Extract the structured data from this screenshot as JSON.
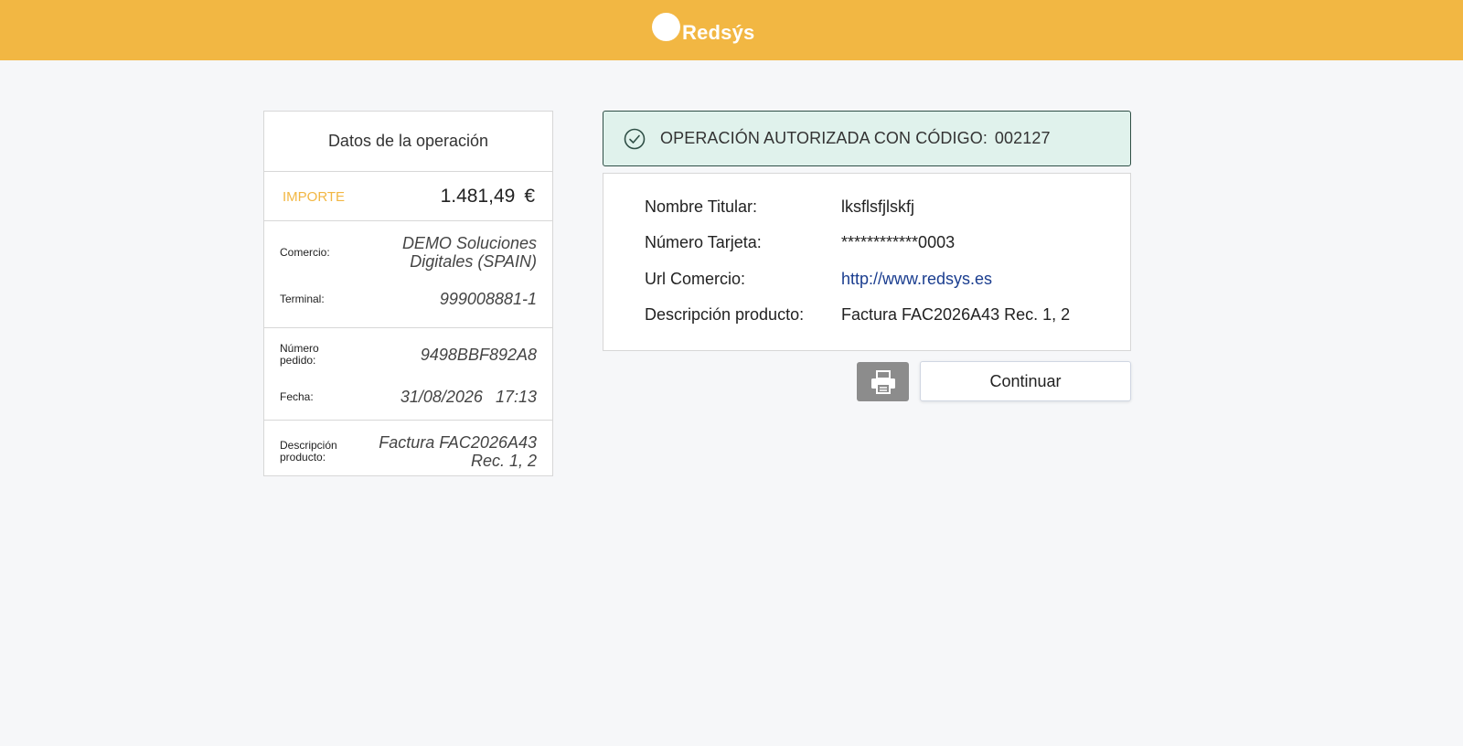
{
  "header": {
    "brand": "Redsýs",
    "bar_color": "#f2b743"
  },
  "operation": {
    "title": "Datos de la operación",
    "amount_label": "IMPORTE",
    "amount_value": "1.481,49",
    "currency": "€",
    "merchant_label": "Comercio:",
    "merchant_value": "DEMO Soluciones Digitales (SPAIN)",
    "terminal_label": "Terminal:",
    "terminal_value": "999008881-1",
    "order_label": "Número pedido:",
    "order_value": "9498BBF892A8",
    "date_label": "Fecha:",
    "date_value": "31/08/2026",
    "time_value": "17:13",
    "product_label": "Descripción producto:",
    "product_value": "Factura FAC2026A43 Rec. 1, 2"
  },
  "result": {
    "status_icon": "check-circle-icon",
    "message": "OPERACIÓN AUTORIZADA CON CÓDIGO:",
    "code": "002127",
    "banner_color": "#e0f2ec"
  },
  "details": {
    "holder_label": "Nombre Titular:",
    "holder_value": "lksflsfjlskfj",
    "card_label": "Número Tarjeta:",
    "card_value": "************0003",
    "url_label": "Url Comercio:",
    "url_value": "http://www.redsys.es",
    "product_label": "Descripción producto:",
    "product_value": "Factura FAC2026A43 Rec. 1, 2"
  },
  "actions": {
    "print_icon": "printer-icon",
    "continue_label": "Continuar"
  }
}
